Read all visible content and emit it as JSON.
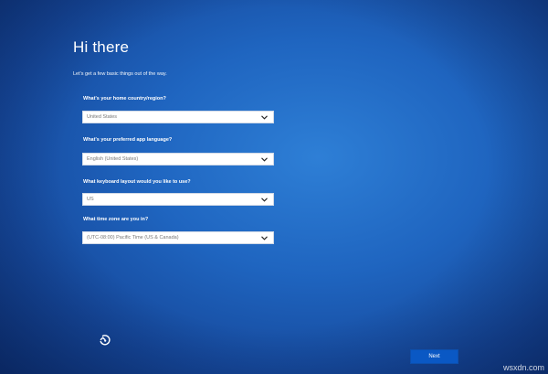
{
  "header": {
    "title": "Hi there",
    "subtitle": "Let's get a few basic things out of the way."
  },
  "fields": [
    {
      "label": "What's your home country/region?",
      "value": "United States"
    },
    {
      "label": "What's your preferred app language?",
      "value": "English (United States)"
    },
    {
      "label": "What keyboard layout would you like to use?",
      "value": "US"
    },
    {
      "label": "What time zone are you in?",
      "value": "(UTC-08:00) Pacific Time (US & Canada)"
    }
  ],
  "footer": {
    "ease_of_access_icon": "ease-of-access-icon",
    "next_label": "Next"
  },
  "watermark": "wsxdn.com",
  "colors": {
    "background": "#1f65c0",
    "button": "#0a58c4",
    "field_background": "#ffffff",
    "field_text": "#777777"
  }
}
